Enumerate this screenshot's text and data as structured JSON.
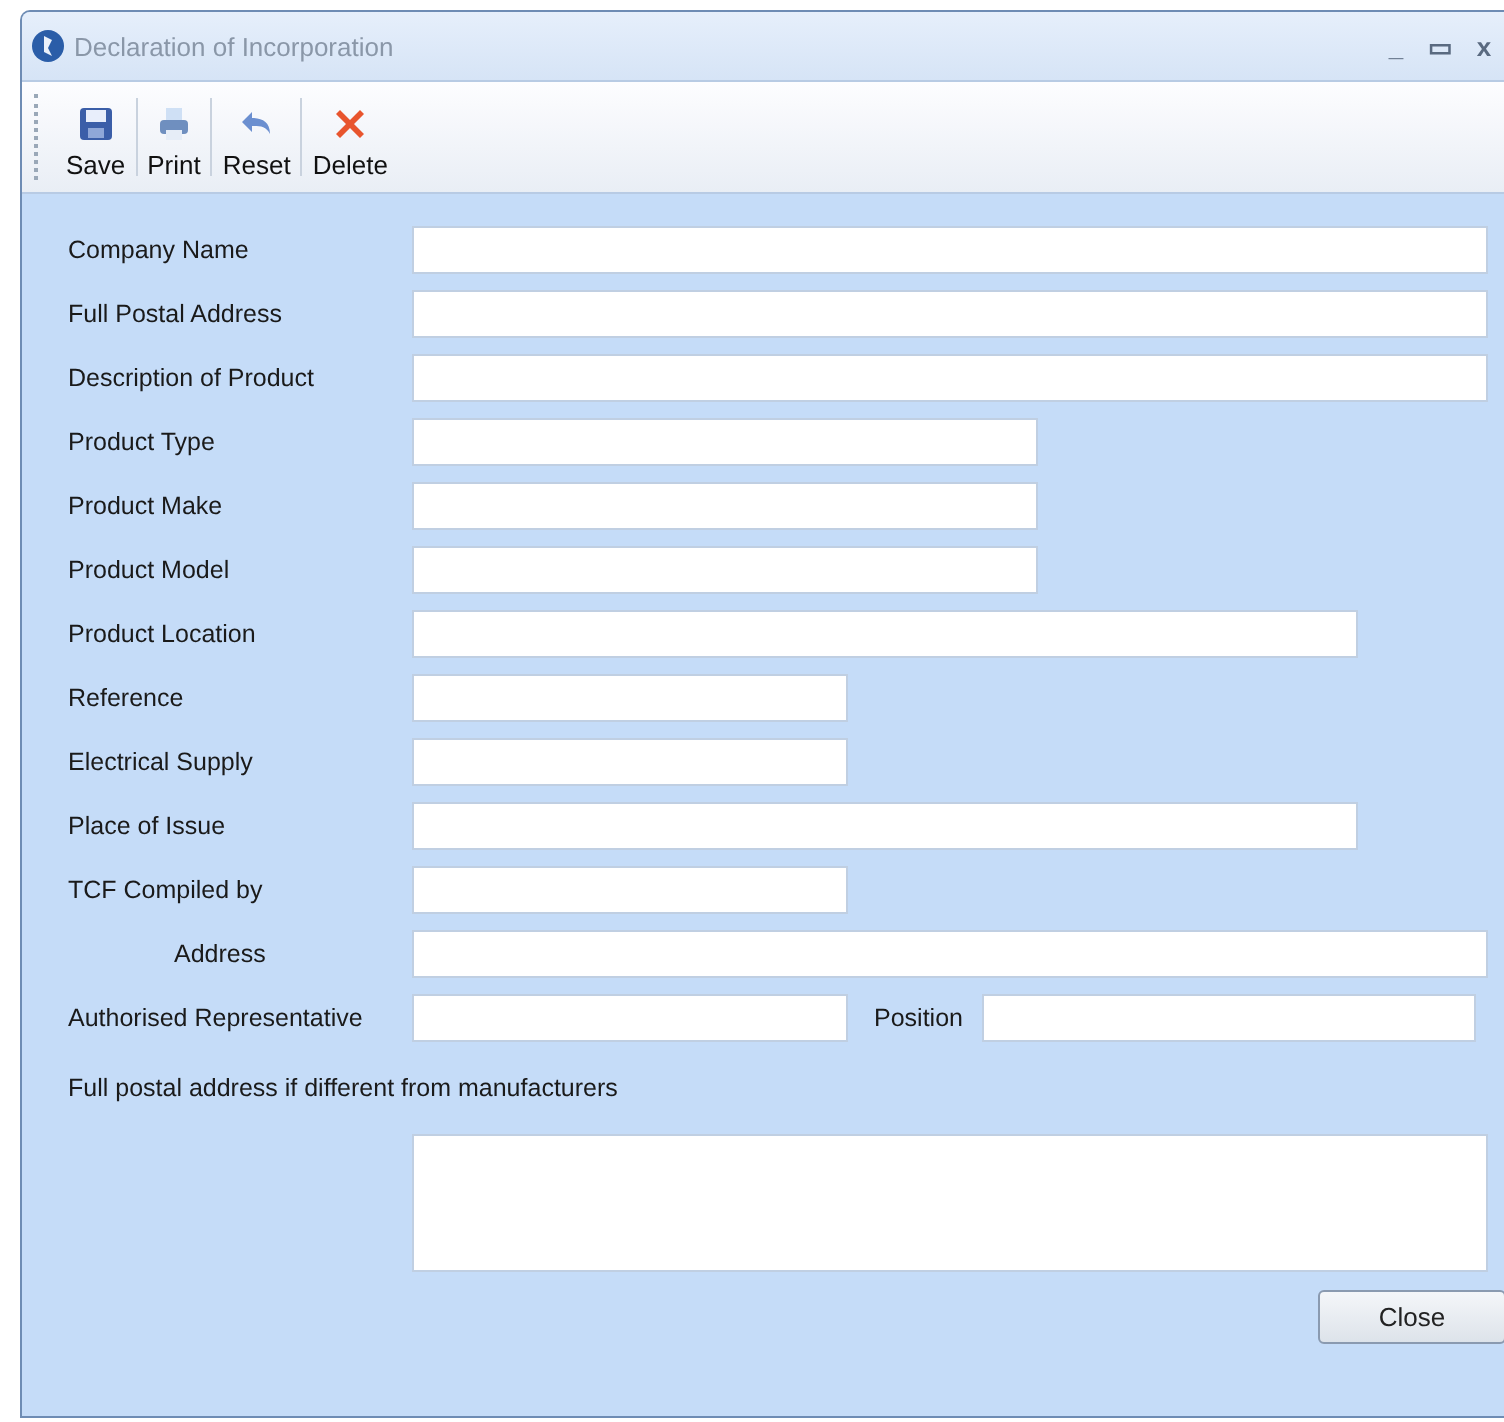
{
  "window": {
    "title": "Declaration of Incorporation",
    "controls": [
      "_",
      "▭",
      "x"
    ]
  },
  "toolbar": [
    {
      "label": "Save",
      "kind": "save"
    },
    {
      "label": "Print",
      "kind": "print"
    },
    {
      "label": "Reset",
      "kind": "reset"
    },
    {
      "label": "Delete",
      "kind": "delete"
    }
  ],
  "fields": [
    {
      "label": "Company Name",
      "kind": "full"
    },
    {
      "label": "Full Postal Address",
      "kind": "full"
    },
    {
      "label": "Description of Product",
      "kind": "full"
    },
    {
      "label": "Product Type",
      "kind": "medium"
    },
    {
      "label": "Product Make",
      "kind": "medium"
    },
    {
      "label": "Product Model",
      "kind": "medium"
    },
    {
      "label": "Product Location",
      "kind": "long"
    },
    {
      "label": "Reference",
      "kind": "short"
    },
    {
      "label": "Electrical Supply",
      "kind": "short"
    },
    {
      "label": "Place of Issue",
      "kind": "long"
    },
    {
      "label": "TCF Compiled by",
      "kind": "short"
    },
    {
      "label": "Address",
      "kind": "full",
      "indented": true
    },
    {
      "label": "Authorised Representative",
      "kind": "short",
      "extra": {
        "label": "Position"
      }
    }
  ],
  "note": "Full postal address if different from manufacturers",
  "close_button": "Close"
}
